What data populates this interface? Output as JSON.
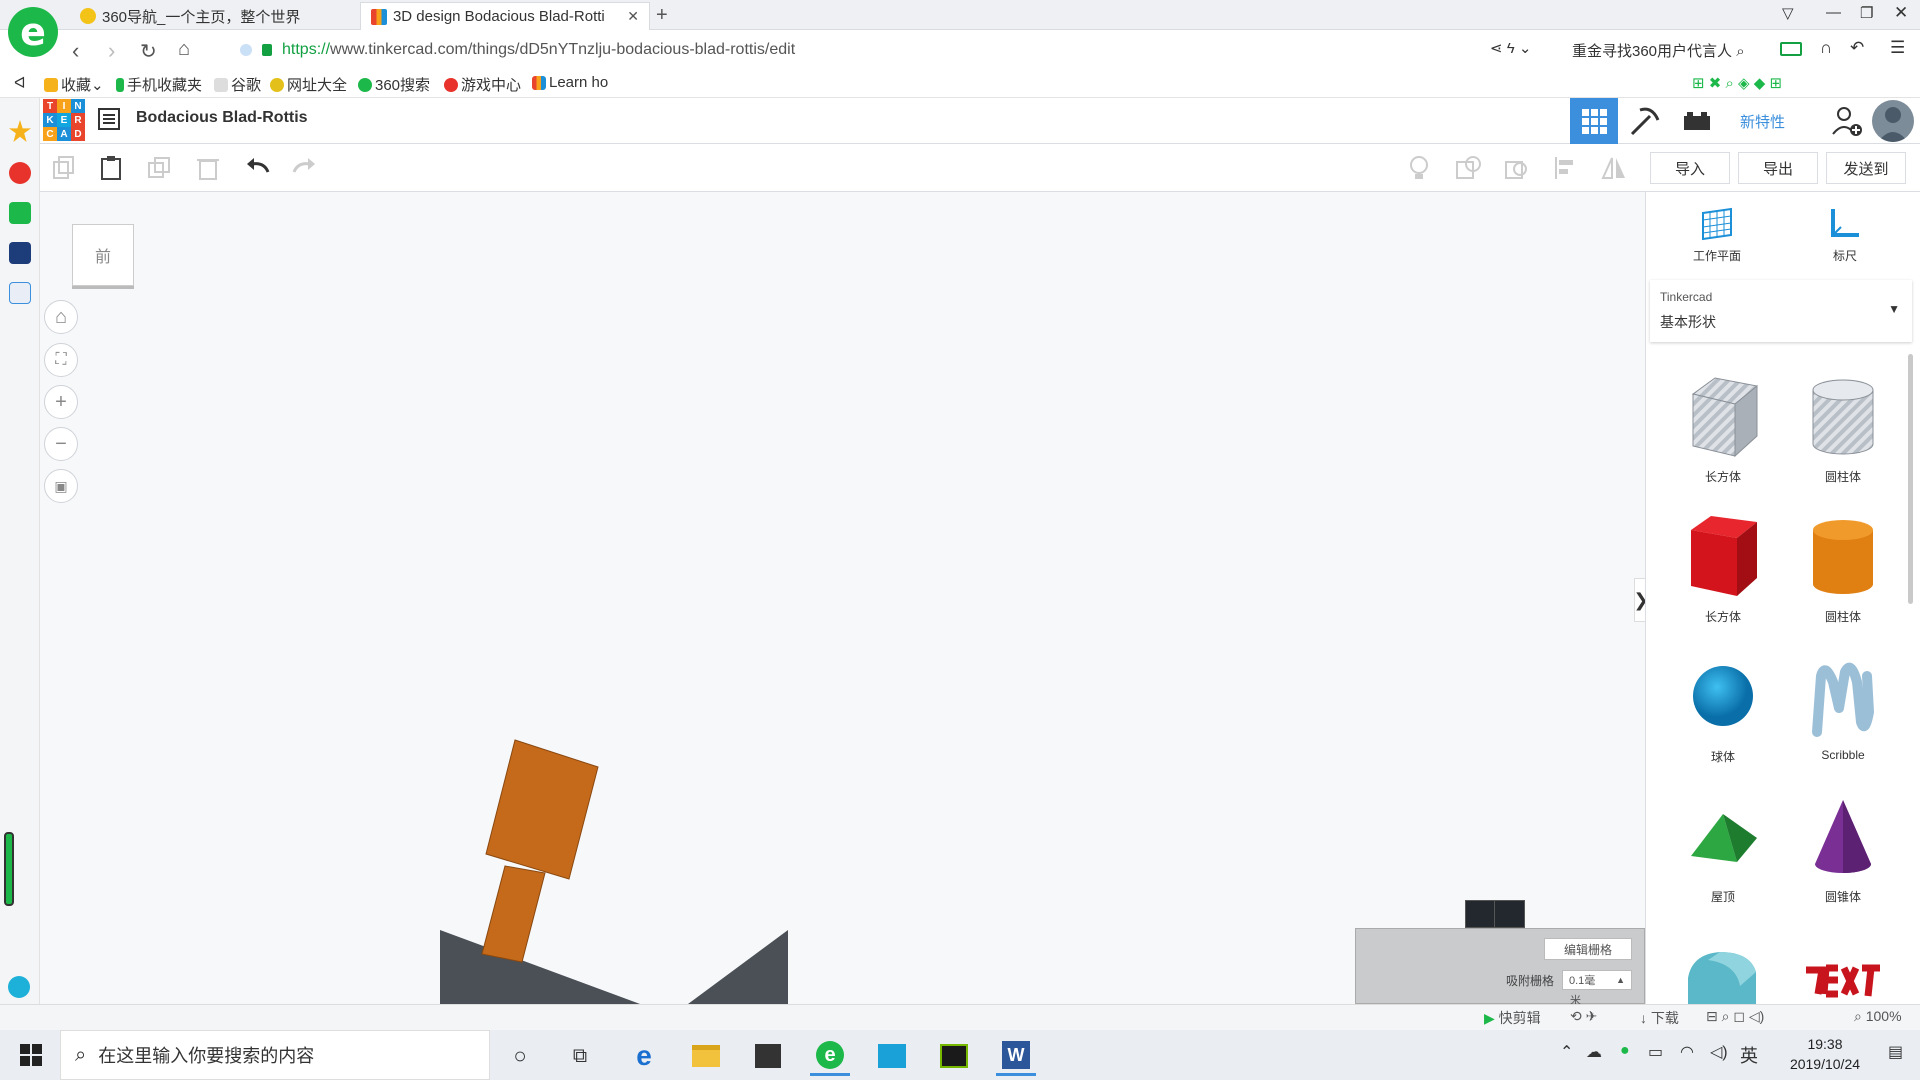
{
  "browser": {
    "tabs": [
      {
        "title": "360导航_一个主页，整个世界"
      },
      {
        "title": "3D design Bodacious Blad-Rotti"
      }
    ],
    "new_tab": "+",
    "url_scheme": "https://",
    "url_rest": "www.tinkercad.com/things/dD5nYTnzlju-bodacious-blad-rottis/edit",
    "promo": "重金寻找360用户代言人",
    "bookmarks": [
      "收藏",
      "手机收藏夹",
      "谷歌",
      "网址大全",
      "360搜索",
      "游戏中心",
      "Learn ho"
    ]
  },
  "tinkercad": {
    "logo_letters": [
      "T",
      "I",
      "N",
      "K",
      "E",
      "R",
      "C",
      "A",
      "D"
    ],
    "logo_colors": [
      "#e8452c",
      "#f8a21b",
      "#1b8fd8",
      "#1b8fd8",
      "#12a6e0",
      "#e8452c",
      "#f8a21b",
      "#1b8fd8",
      "#e8452c"
    ],
    "design_title": "Bodacious Blad-Rottis",
    "new_features": "新特性",
    "actions": {
      "import": "导入",
      "export": "导出",
      "send_to": "发送到"
    },
    "view_cube_label": "前",
    "workplane": "工作平面",
    "ruler": "标尺",
    "library_source": "Tinkercad",
    "library_name": "基本形状",
    "shapes": [
      {
        "label": "长方体",
        "kind": "box-hole"
      },
      {
        "label": "圆柱体",
        "kind": "cylinder-hole"
      },
      {
        "label": "长方体",
        "kind": "box"
      },
      {
        "label": "圆柱体",
        "kind": "cylinder"
      },
      {
        "label": "球体",
        "kind": "sphere"
      },
      {
        "label": "Scribble",
        "kind": "scribble"
      },
      {
        "label": "屋顶",
        "kind": "roof"
      },
      {
        "label": "圆锥体",
        "kind": "cone"
      }
    ],
    "edit_grid": "编辑栅格",
    "snap_grid_label": "吸附栅格",
    "snap_grid_value": "0.1毫",
    "snap_grid_unit": "米"
  },
  "statusbar": {
    "clip": "快剪辑",
    "download": "下载",
    "zoom": "100%"
  },
  "taskbar": {
    "search_placeholder": "在这里输入你要搜索的内容",
    "ime": "英",
    "time": "19:38",
    "date": "2019/10/24"
  },
  "colors": {
    "accent": "#3b8fdc",
    "brand_green": "#1db84a",
    "orange_part": "#c46a1a",
    "dark_part": "#4a5056"
  }
}
